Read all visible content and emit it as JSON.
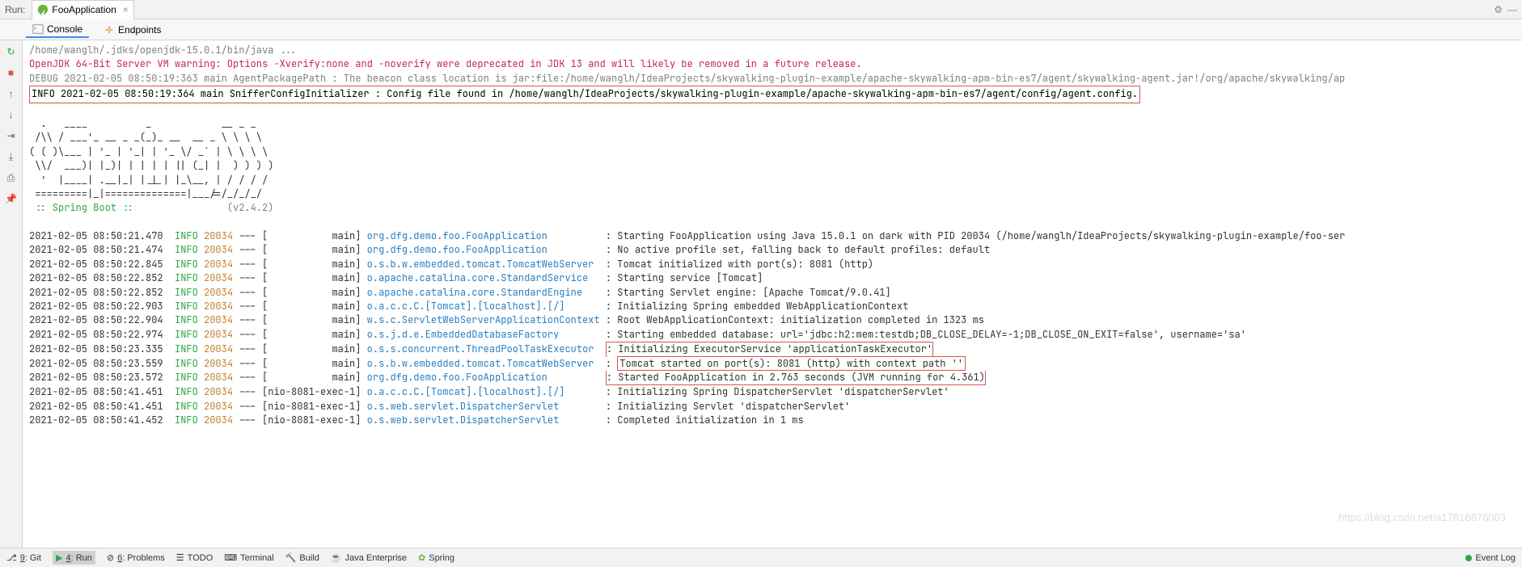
{
  "topbar": {
    "run_label": "Run:",
    "tab_name": "FooApplication",
    "tab_close": "×"
  },
  "subtabs": {
    "console": "Console",
    "endpoints": "Endpoints"
  },
  "gutter": {
    "rerun": "↻",
    "stop": "■",
    "up": "↑",
    "down": "↓",
    "layout": "⊞",
    "export": "⇥",
    "print": "⎙",
    "pin": "📌"
  },
  "console": {
    "cmd": "/home/wanglh/.jdks/openjdk-15.0.1/bin/java ...",
    "warn": "OpenJDK 64-Bit Server VM warning: Options -Xverify:none and -noverify were deprecated in JDK 13 and will likely be removed in a future release.",
    "debug": "DEBUG 2021-02-05 08:50:19:363 main AgentPackagePath : The beacon class location is jar:file:/home/wanglh/IdeaProjects/skywalking-plugin-example/apache-skywalking-apm-bin-es7/agent/skywalking-agent.jar!/org/apache/skywalking/ap",
    "info_hl": "INFO 2021-02-05 08:50:19:364 main SnifferConfigInitializer : Config file found in /home/wanglh/IdeaProjects/skywalking-plugin-example/apache-skywalking-apm-bin-es7/agent/config/agent.config.",
    "ascii1": "  .   ____          _            __ _ _",
    "ascii2": " /\\\\ / ___'_ __ _ _(_)_ __  __ _ \\ \\ \\ \\",
    "ascii3": "( ( )\\___ | '_ | '_| | '_ \\/ _` | \\ \\ \\ \\",
    "ascii4": " \\\\/  ___)| |_)| | | | | || (_| |  ) ) ) )",
    "ascii5": "  '  |____| .__|_| |_|_| |_\\__, | / / / /",
    "ascii6": " =========|_|==============|___/=/_/_/_/",
    "spring": " :: Spring Boot ::",
    "spring_ver": "                (v2.4.2)",
    "logs": [
      {
        "ts": "2021-02-05 08:50:21.470",
        "level": "INFO",
        "pid": "20034",
        "thread": "           main",
        "cls": "org.dfg.demo.foo.FooApplication         ",
        "msg": ": Starting FooApplication using Java 15.0.1 on dark with PID 20034 (/home/wanglh/IdeaProjects/skywalking-plugin-example/foo-ser"
      },
      {
        "ts": "2021-02-05 08:50:21.474",
        "level": "INFO",
        "pid": "20034",
        "thread": "           main",
        "cls": "org.dfg.demo.foo.FooApplication         ",
        "msg": ": No active profile set, falling back to default profiles: default"
      },
      {
        "ts": "2021-02-05 08:50:22.845",
        "level": "INFO",
        "pid": "20034",
        "thread": "           main",
        "cls": "o.s.b.w.embedded.tomcat.TomcatWebServer ",
        "msg": ": Tomcat initialized with port(s): 8081 (http)"
      },
      {
        "ts": "2021-02-05 08:50:22.852",
        "level": "INFO",
        "pid": "20034",
        "thread": "           main",
        "cls": "o.apache.catalina.core.StandardService  ",
        "msg": ": Starting service [Tomcat]"
      },
      {
        "ts": "2021-02-05 08:50:22.852",
        "level": "INFO",
        "pid": "20034",
        "thread": "           main",
        "cls": "o.apache.catalina.core.StandardEngine   ",
        "msg": ": Starting Servlet engine: [Apache Tomcat/9.0.41]"
      },
      {
        "ts": "2021-02-05 08:50:22.903",
        "level": "INFO",
        "pid": "20034",
        "thread": "           main",
        "cls": "o.a.c.c.C.[Tomcat].[localhost].[/]      ",
        "msg": ": Initializing Spring embedded WebApplicationContext"
      },
      {
        "ts": "2021-02-05 08:50:22.904",
        "level": "INFO",
        "pid": "20034",
        "thread": "           main",
        "cls": "w.s.c.ServletWebServerApplicationContext",
        "msg": ": Root WebApplicationContext: initialization completed in 1323 ms"
      },
      {
        "ts": "2021-02-05 08:50:22.974",
        "level": "INFO",
        "pid": "20034",
        "thread": "           main",
        "cls": "o.s.j.d.e.EmbeddedDatabaseFactory       ",
        "msg": ": Starting embedded database: url='jdbc:h2:mem:testdb;DB_CLOSE_DELAY=-1;DB_CLOSE_ON_EXIT=false', username='sa'"
      },
      {
        "ts": "2021-02-05 08:50:23.335",
        "level": "INFO",
        "pid": "20034",
        "thread": "           main",
        "cls": "o.s.s.concurrent.ThreadPoolTaskExecutor ",
        "msg": ": Initializing ExecutorService 'applicationTaskExecutor'",
        "box_top": true
      },
      {
        "ts": "2021-02-05 08:50:23.559",
        "level": "INFO",
        "pid": "20034",
        "thread": "           main",
        "cls": "o.s.b.w.embedded.tomcat.TomcatWebServer ",
        "msg": ": Tomcat started on port(s): 8081 (http) with context path ''",
        "box": true
      },
      {
        "ts": "2021-02-05 08:50:23.572",
        "level": "INFO",
        "pid": "20034",
        "thread": "           main",
        "cls": "org.dfg.demo.foo.FooApplication         ",
        "msg": ": Started FooApplication in 2.763 seconds (JVM running for 4.361)",
        "box_bot": true
      },
      {
        "ts": "2021-02-05 08:50:41.451",
        "level": "INFO",
        "pid": "20034",
        "thread": "nio-8081-exec-1",
        "cls": "o.a.c.c.C.[Tomcat].[localhost].[/]      ",
        "msg": ": Initializing Spring DispatcherServlet 'dispatcherServlet'"
      },
      {
        "ts": "2021-02-05 08:50:41.451",
        "level": "INFO",
        "pid": "20034",
        "thread": "nio-8081-exec-1",
        "cls": "o.s.web.servlet.DispatcherServlet       ",
        "msg": ": Initializing Servlet 'dispatcherServlet'"
      },
      {
        "ts": "2021-02-05 08:50:41.452",
        "level": "INFO",
        "pid": "20034",
        "thread": "nio-8081-exec-1",
        "cls": "o.s.web.servlet.DispatcherServlet       ",
        "msg": ": Completed initialization in 1 ms"
      }
    ]
  },
  "statusbar": {
    "git": "9: Git",
    "run": "4: Run",
    "problems": "6: Problems",
    "todo": "TODO",
    "terminal": "Terminal",
    "build": "Build",
    "jee": "Java Enterprise",
    "spring": "Spring",
    "event_log": "Event Log"
  },
  "watermark": "https://blog.csdn.net/a17816876003"
}
